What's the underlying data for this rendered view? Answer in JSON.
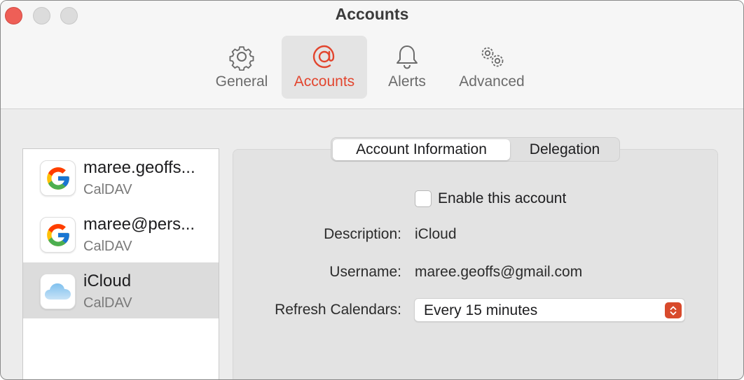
{
  "window": {
    "title": "Accounts"
  },
  "toolbar": {
    "tabs": [
      {
        "label": "General",
        "icon": "gear-icon"
      },
      {
        "label": "Accounts",
        "icon": "at-sign-icon",
        "selected": true
      },
      {
        "label": "Alerts",
        "icon": "bell-icon"
      },
      {
        "label": "Advanced",
        "icon": "gears-icon"
      }
    ]
  },
  "accounts": [
    {
      "name": "maree.geoffs...",
      "type": "CalDAV",
      "icon": "google-icon"
    },
    {
      "name": "maree@pers...",
      "type": "CalDAV",
      "icon": "google-icon"
    },
    {
      "name": "iCloud",
      "type": "CalDAV",
      "icon": "icloud-icon",
      "selected": true
    }
  ],
  "detail": {
    "segments": [
      "Account Information",
      "Delegation"
    ],
    "active_segment": "Account Information",
    "enable_label": "Enable this account",
    "enable_checked": false,
    "description_label": "Description:",
    "description_value": "iCloud",
    "username_label": "Username:",
    "username_value": "maree.geoffs@gmail.com",
    "refresh_label": "Refresh Calendars:",
    "refresh_value": "Every 15 minutes"
  },
  "colors": {
    "accent": "#e2452e",
    "close_button": "#ee5f57",
    "stepper": "#d84a2c"
  }
}
